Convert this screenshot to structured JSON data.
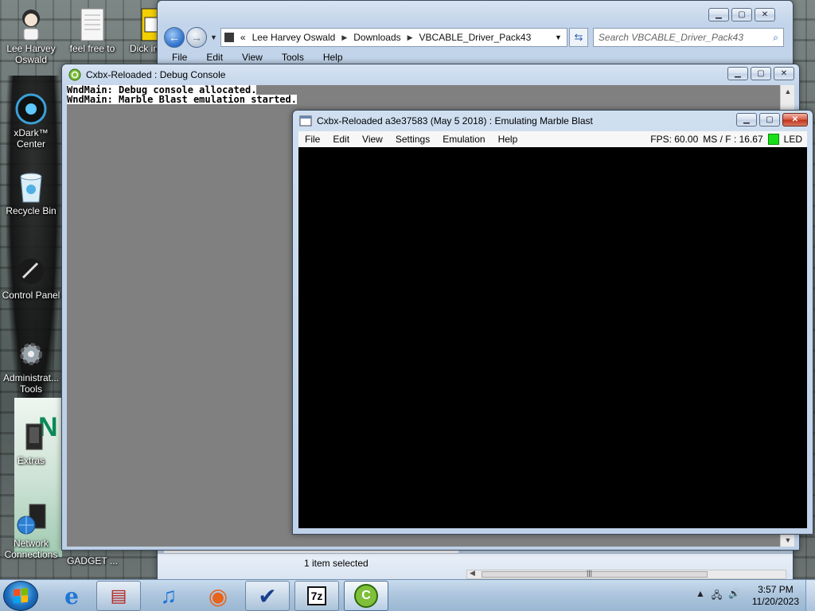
{
  "desktop": {
    "icons": [
      {
        "label": "Lee Harvey Oswald",
        "icon": "user-folder-icon"
      },
      {
        "label": "feel free to",
        "icon": "document-icon"
      },
      {
        "label": "Dick in",
        "icon": "document-icon"
      },
      {
        "label": "xDark™ Center",
        "icon": "xdark-center-icon"
      },
      {
        "label": "Recycle Bin",
        "icon": "recycle-bin-icon"
      },
      {
        "label": "Control Panel",
        "icon": "control-panel-icon"
      },
      {
        "label": "Administrat... Tools",
        "icon": "admin-tools-icon"
      },
      {
        "label": "Extras",
        "icon": "folder-icon"
      },
      {
        "label": "Network Connections",
        "icon": "network-icon"
      },
      {
        "label": "GADGET ...",
        "icon": "gadget-icon"
      }
    ],
    "sign_letter": "N"
  },
  "explorer": {
    "breadcrumb": [
      "Lee Harvey Oswald",
      "Downloads",
      "VBCABLE_Driver_Pack43"
    ],
    "breadcrumb_prefix": "«",
    "search_placeholder": "Search VBCABLE_Driver_Pack43",
    "menu": [
      "File",
      "Edit",
      "View",
      "Tools",
      "Help"
    ],
    "status": "1 item selected",
    "scroll_grip": "|||"
  },
  "console": {
    "title": "Cxbx-Reloaded : Debug Console",
    "lines": [
      "WndMain: Debug console allocated.",
      "WndMain: Marble Blast emulation started."
    ]
  },
  "emulator": {
    "title": "Cxbx-Reloaded a3e37583 (May  5 2018) : Emulating Marble Blast",
    "menu": [
      "File",
      "Edit",
      "View",
      "Settings",
      "Emulation",
      "Help"
    ],
    "fps": "FPS: 60.00",
    "ms": "MS / F : 16.67",
    "led_label": "LED",
    "led_color": "#18e018"
  },
  "taskbar": {
    "items": [
      {
        "name": "internet-explorer-icon",
        "glyph": "e"
      },
      {
        "name": "archive-manager-icon",
        "glyph": "▤"
      },
      {
        "name": "itunes-icon",
        "glyph": "♫"
      },
      {
        "name": "firefox-icon",
        "glyph": "◉"
      },
      {
        "name": "checkmark-app-icon",
        "glyph": "✔"
      },
      {
        "name": "7zip-icon",
        "glyph": "7z"
      },
      {
        "name": "cxbx-reloaded-icon",
        "glyph": "C"
      }
    ],
    "time": "3:57 PM",
    "date": "11/20/2023"
  }
}
